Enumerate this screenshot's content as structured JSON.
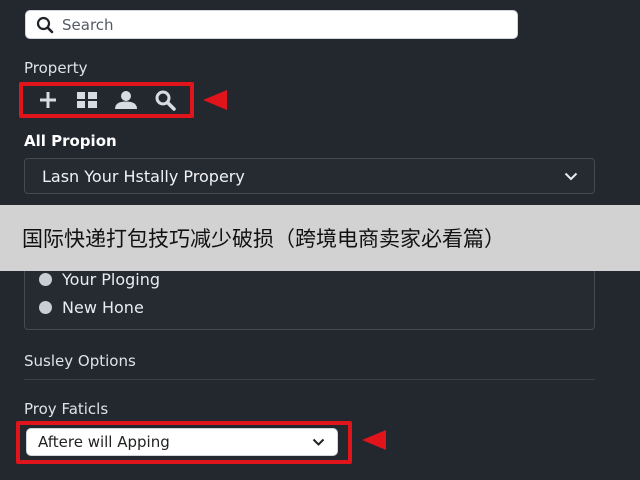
{
  "search": {
    "placeholder": "Search"
  },
  "property": {
    "label": "Property",
    "toolbar": [
      {
        "icon": "plus-icon"
      },
      {
        "icon": "grid-icon"
      },
      {
        "icon": "user-icon"
      },
      {
        "icon": "search-icon"
      }
    ]
  },
  "all_propion": {
    "label": "All Propion",
    "selected": "Lasn Your Hstally Propery"
  },
  "radio_options": [
    "Your Ploging",
    "New Hone"
  ],
  "susley": {
    "label": "Susley Options"
  },
  "proy": {
    "label": "Proy Faticls",
    "selected": "Aftere will Apping"
  },
  "banner": {
    "text": "国际快递打包技巧减少破损（跨境电商卖家必看篇）"
  },
  "colors": {
    "accent": "#e0141b",
    "background": "#23272e",
    "banner": "#d2d2d2"
  }
}
